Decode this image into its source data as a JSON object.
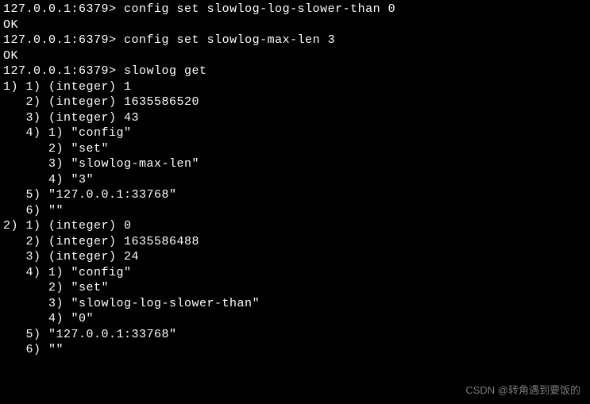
{
  "prompt": "127.0.0.1:6379>",
  "commands": [
    {
      "input": "config set slowlog-log-slower-than 0",
      "output": "OK"
    },
    {
      "input": "config set slowlog-max-len 3",
      "output": "OK"
    },
    {
      "input": "slowlog get"
    }
  ],
  "slowlog": [
    {
      "id": 1,
      "timestamp": 1635586520,
      "duration": 43,
      "command": [
        "config",
        "set",
        "slowlog-max-len",
        "3"
      ],
      "client": "127.0.0.1:33768",
      "name": ""
    },
    {
      "id": 0,
      "timestamp": 1635586488,
      "duration": 24,
      "command": [
        "config",
        "set",
        "slowlog-log-slower-than",
        "0"
      ],
      "client": "127.0.0.1:33768",
      "name": ""
    }
  ],
  "watermark": "CSDN @转角遇到要饭的"
}
